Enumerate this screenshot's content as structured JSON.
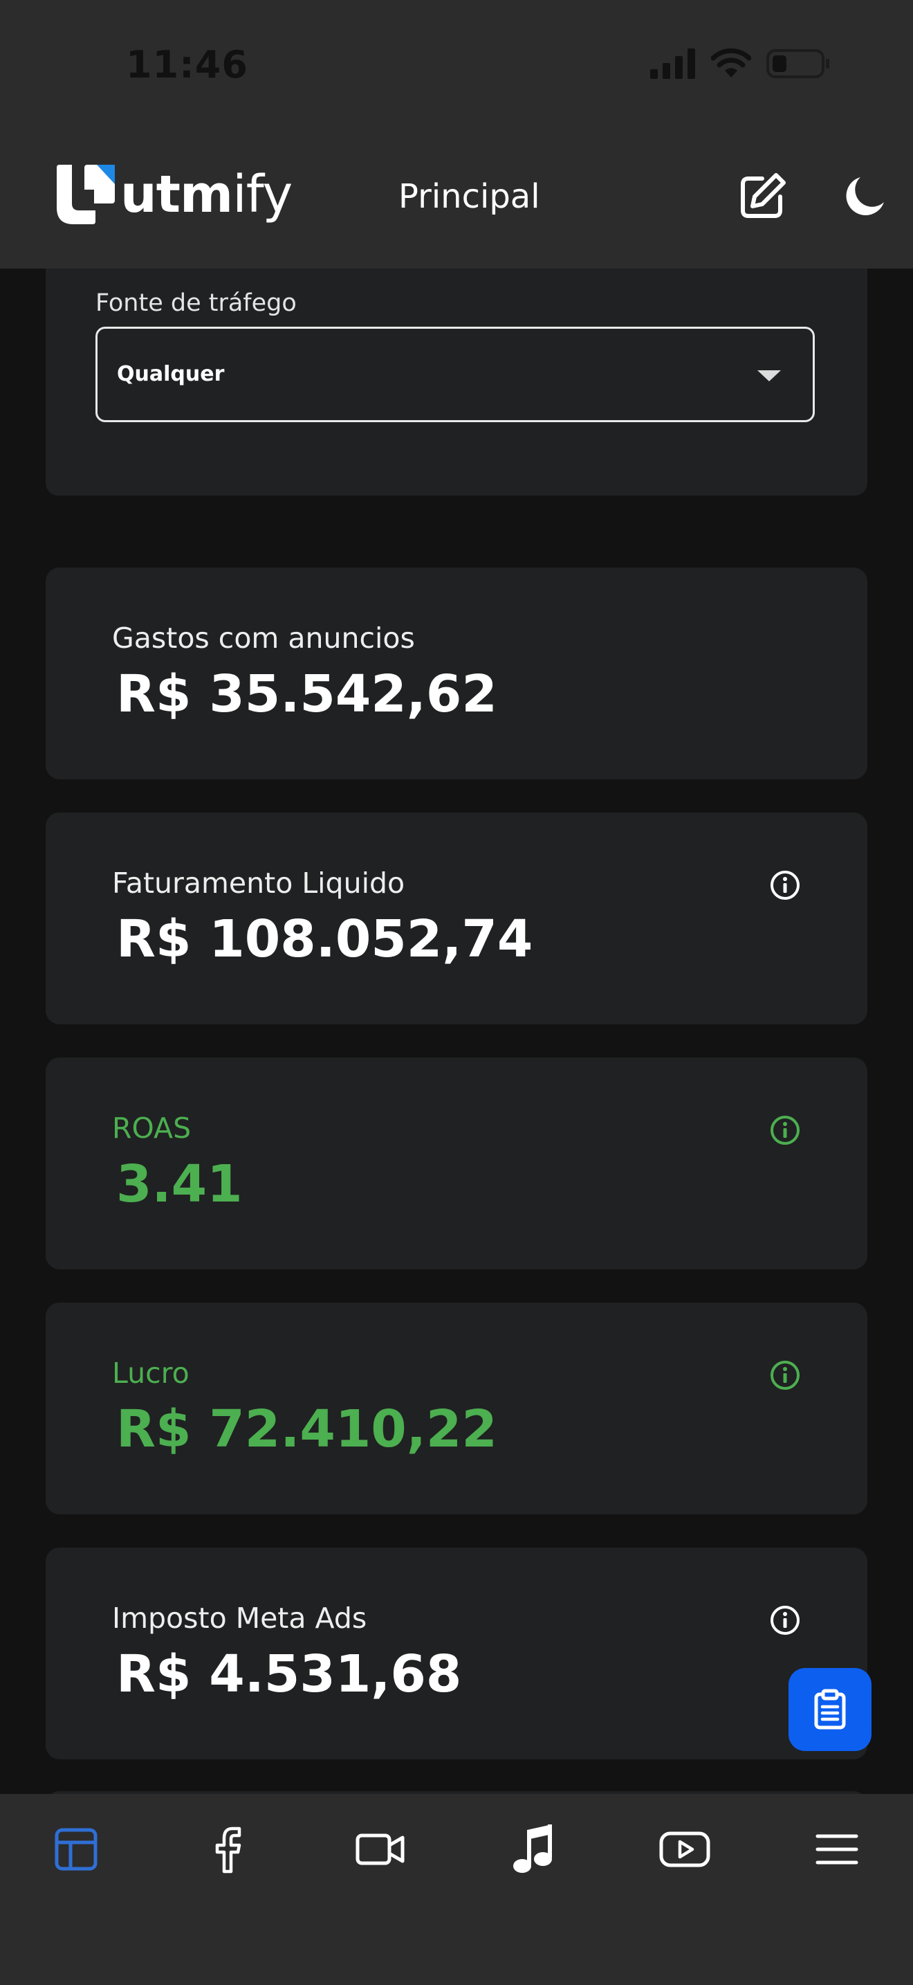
{
  "status_bar": {
    "time": "11:46"
  },
  "header": {
    "brand_bold": "utm",
    "brand_light": "ify",
    "title": "Principal"
  },
  "filter": {
    "label": "Fonte de tráfego",
    "selected": "Qualquer"
  },
  "metrics": [
    {
      "label": "Gastos com anuncios",
      "value": "R$ 35.542,62",
      "color": "#ffffff",
      "has_info": false
    },
    {
      "label": "Faturamento Liquido",
      "value": "R$ 108.052,74",
      "color": "#ffffff",
      "has_info": true
    },
    {
      "label": "ROAS",
      "value": "3.41",
      "color": "#4caf50",
      "has_info": true
    },
    {
      "label": "Lucro",
      "value": "R$ 72.410,22",
      "color": "#4caf50",
      "has_info": true
    },
    {
      "label": "Imposto Meta Ads",
      "value": "R$ 4.531,68",
      "color": "#ffffff",
      "has_info": true
    }
  ],
  "bottom_nav": {
    "items": [
      {
        "icon": "dashboard-icon",
        "active": true
      },
      {
        "icon": "facebook-icon",
        "active": false
      },
      {
        "icon": "video-icon",
        "active": false
      },
      {
        "icon": "music-note-icon",
        "active": false
      },
      {
        "icon": "youtube-icon",
        "active": false
      },
      {
        "icon": "menu-icon",
        "active": false
      }
    ]
  },
  "colors": {
    "accent": "#0d5ff0",
    "active_nav": "#2f6fd6",
    "positive": "#4caf50",
    "background": "#121212",
    "card": "#202122",
    "bar": "#2c2c2d"
  }
}
